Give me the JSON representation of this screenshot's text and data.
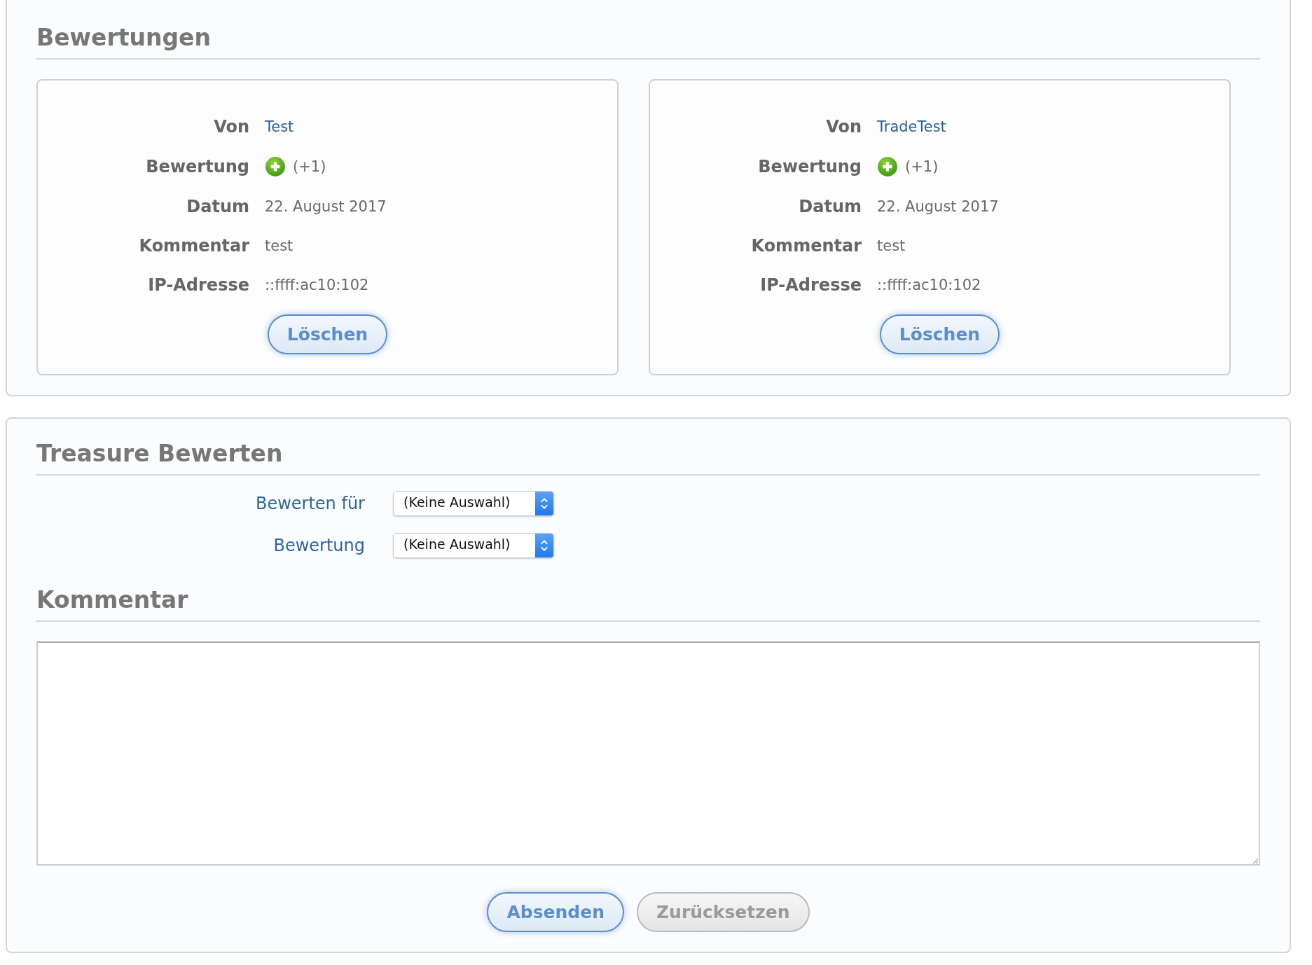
{
  "ratings_section": {
    "title": "Bewertungen",
    "ratings": [
      {
        "from_label": "Von",
        "from": "Test",
        "rating_label": "Bewertung",
        "rating": {
          "kind": "positive",
          "text": "(+1)"
        },
        "date_label": "Datum",
        "date": "22. August 2017",
        "comment_label": "Kommentar",
        "comment": "test",
        "ip_label": "IP-Adresse",
        "ip": "::ffff:ac10:102",
        "delete_button": "Löschen"
      },
      {
        "from_label": "Von",
        "from": "TradeTest",
        "rating_label": "Bewertung",
        "rating": {
          "kind": "positive",
          "text": "(+1)"
        },
        "date_label": "Datum",
        "date": "22. August 2017",
        "comment_label": "Kommentar",
        "comment": "test",
        "ip_label": "IP-Adresse",
        "ip": "::ffff:ac10:102",
        "delete_button": "Löschen"
      }
    ]
  },
  "rate_section": {
    "title": "Treasure Bewerten",
    "fields": [
      {
        "label": "Bewerten für",
        "value": "(Keine Auswahl)"
      },
      {
        "label": "Bewertung",
        "value": "(Keine Auswahl)"
      }
    ],
    "comment_title": "Kommentar",
    "buttons": [
      {
        "label": "Absenden",
        "kind": "primary"
      },
      {
        "label": "Zurücksetzen",
        "kind": "secondary"
      }
    ]
  }
}
